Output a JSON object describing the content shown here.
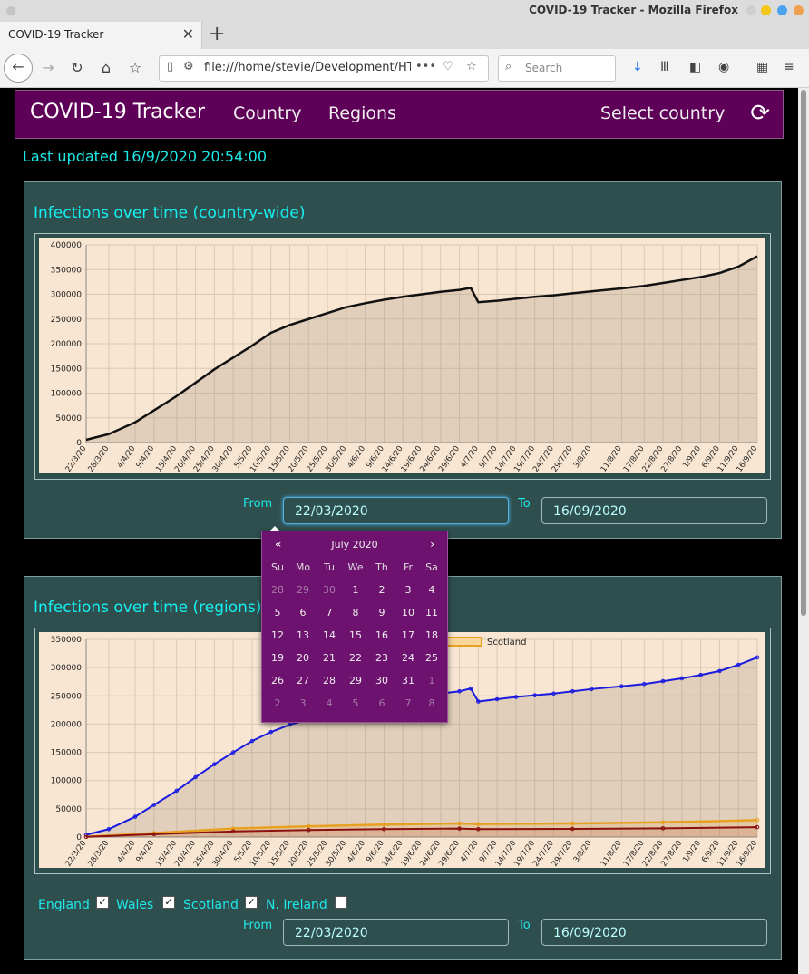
{
  "window": {
    "title": "COVID-19 Tracker - Mozilla Firefox"
  },
  "browser": {
    "tab_title": "COVID-19 Tracker",
    "url": "file:///home/stevie/Development/HT",
    "search_placeholder": "Search"
  },
  "app": {
    "brand": "COVID-19 Tracker",
    "nav": {
      "country": "Country",
      "regions": "Regions",
      "select_country": "Select country"
    },
    "last_updated": "Last updated 16/9/2020 20:54:00"
  },
  "country_chart": {
    "title": "Infections over time (country-wide)",
    "from_label": "From",
    "to_label": "To",
    "from_value": "22/03/2020",
    "to_value": "16/09/2020"
  },
  "regions_chart": {
    "title": "Infections over time (regions)",
    "from_label": "From",
    "to_label": "To",
    "from_value": "22/03/2020",
    "to_value": "16/09/2020",
    "checkboxes": [
      {
        "label": "England",
        "checked": true
      },
      {
        "label": "Wales",
        "checked": true
      },
      {
        "label": "Scotland",
        "checked": true
      },
      {
        "label": "N. Ireland",
        "checked": false
      }
    ]
  },
  "datepicker": {
    "month_label": "July 2020",
    "prev": "«",
    "next": "›",
    "weekdays": [
      "Su",
      "Mo",
      "Tu",
      "We",
      "Th",
      "Fr",
      "Sa"
    ],
    "weeks": [
      [
        {
          "d": "28",
          "m": true
        },
        {
          "d": "29",
          "m": true
        },
        {
          "d": "30",
          "m": true
        },
        {
          "d": "1"
        },
        {
          "d": "2"
        },
        {
          "d": "3"
        },
        {
          "d": "4"
        }
      ],
      [
        {
          "d": "5"
        },
        {
          "d": "6"
        },
        {
          "d": "7"
        },
        {
          "d": "8"
        },
        {
          "d": "9"
        },
        {
          "d": "10"
        },
        {
          "d": "11"
        }
      ],
      [
        {
          "d": "12"
        },
        {
          "d": "13"
        },
        {
          "d": "14"
        },
        {
          "d": "15"
        },
        {
          "d": "16"
        },
        {
          "d": "17"
        },
        {
          "d": "18"
        }
      ],
      [
        {
          "d": "19"
        },
        {
          "d": "20"
        },
        {
          "d": "21"
        },
        {
          "d": "22"
        },
        {
          "d": "23"
        },
        {
          "d": "24"
        },
        {
          "d": "25"
        }
      ],
      [
        {
          "d": "26"
        },
        {
          "d": "27"
        },
        {
          "d": "28"
        },
        {
          "d": "29"
        },
        {
          "d": "30"
        },
        {
          "d": "31"
        },
        {
          "d": "1",
          "m": true
        }
      ],
      [
        {
          "d": "2",
          "m": true
        },
        {
          "d": "3",
          "m": true
        },
        {
          "d": "4",
          "m": true
        },
        {
          "d": "5",
          "m": true
        },
        {
          "d": "6",
          "m": true
        },
        {
          "d": "7",
          "m": true
        },
        {
          "d": "8",
          "m": true
        }
      ]
    ]
  },
  "colors": {
    "navbar": "#5e0057",
    "card": "#2f4f4f",
    "accent_text": "#16f0f0",
    "chart_bg": "#f8e6d2",
    "picker": "#6e1270"
  },
  "chart_data": [
    {
      "type": "area",
      "ylim": [
        0,
        400000
      ],
      "yticks": [
        0,
        50000,
        100000,
        150000,
        200000,
        250000,
        300000,
        350000,
        400000
      ],
      "yticks_labels": [
        "0",
        "50000",
        "100000",
        "150000",
        "200000",
        "250000",
        "300000",
        "350000",
        "400000"
      ],
      "xtick_labels": [
        "22/3/20",
        "28/3/20",
        "4/4/20",
        "9/4/20",
        "15/4/20",
        "20/4/20",
        "25/4/20",
        "30/4/20",
        "5/5/20",
        "10/5/20",
        "15/5/20",
        "20/5/20",
        "25/5/20",
        "30/5/20",
        "4/6/20",
        "9/6/20",
        "14/6/20",
        "19/6/20",
        "24/6/20",
        "29/6/20",
        "4/7/20",
        "9/7/20",
        "14/7/20",
        "19/7/20",
        "24/7/20",
        "29/7/20",
        "3/8/20",
        "11/8/20",
        "17/8/20",
        "22/8/20",
        "27/8/20",
        "1/9/20",
        "6/9/20",
        "11/9/20",
        "16/9/20"
      ],
      "series": [
        {
          "color": "#111111",
          "x": [
            "22/3/20",
            "28/3/20",
            "4/4/20",
            "9/4/20",
            "15/4/20",
            "20/4/20",
            "25/4/20",
            "30/4/20",
            "5/5/20",
            "10/5/20",
            "15/5/20",
            "20/5/20",
            "25/5/20",
            "30/5/20",
            "4/6/20",
            "9/6/20",
            "14/6/20",
            "19/6/20",
            "24/6/20",
            "29/6/20",
            "2/7/20",
            "4/7/20",
            "9/7/20",
            "14/7/20",
            "19/7/20",
            "24/7/20",
            "29/7/20",
            "3/8/20",
            "11/8/20",
            "17/8/20",
            "22/8/20",
            "27/8/20",
            "1/9/20",
            "6/9/20",
            "11/9/20",
            "16/9/20"
          ],
          "values": [
            5500,
            17000,
            41000,
            65000,
            94000,
            121000,
            148000,
            172000,
            196000,
            222000,
            238000,
            250000,
            262000,
            274000,
            282000,
            289000,
            295000,
            300000,
            305000,
            309000,
            313000,
            284000,
            287000,
            291000,
            295000,
            298000,
            302000,
            306000,
            312000,
            317000,
            323000,
            329000,
            335000,
            343000,
            356000,
            377000
          ]
        }
      ]
    },
    {
      "type": "area",
      "ylim": [
        0,
        350000
      ],
      "yticks": [
        0,
        50000,
        100000,
        150000,
        200000,
        250000,
        300000,
        350000
      ],
      "yticks_labels": [
        "0",
        "50000",
        "100000",
        "150000",
        "200000",
        "250000",
        "300000",
        "350000"
      ],
      "legend": {
        "placement": "top",
        "visible_entries": [
          "Scotland"
        ]
      },
      "xtick_labels": [
        "22/3/20",
        "28/3/20",
        "4/4/20",
        "9/4/20",
        "15/4/20",
        "20/4/20",
        "25/4/20",
        "30/4/20",
        "5/5/20",
        "10/5/20",
        "15/5/20",
        "20/5/20",
        "25/5/20",
        "30/5/20",
        "4/6/20",
        "9/6/20",
        "14/6/20",
        "19/6/20",
        "24/6/20",
        "29/6/20",
        "4/7/20",
        "9/7/20",
        "14/7/20",
        "19/7/20",
        "24/7/20",
        "29/7/20",
        "3/8/20",
        "11/8/20",
        "17/8/20",
        "22/8/20",
        "27/8/20",
        "1/9/20",
        "6/9/20",
        "11/9/20",
        "16/9/20"
      ],
      "series": [
        {
          "color": "#1a1ae0",
          "x": [
            "22/3/20",
            "28/3/20",
            "4/4/20",
            "9/4/20",
            "15/4/20",
            "20/4/20",
            "25/4/20",
            "30/4/20",
            "5/5/20",
            "10/5/20",
            "15/5/20",
            "20/5/20",
            "25/5/20",
            "30/5/20",
            "4/6/20",
            "9/6/20",
            "14/6/20",
            "19/6/20",
            "24/6/20",
            "29/6/20",
            "2/7/20",
            "4/7/20",
            "9/7/20",
            "14/7/20",
            "19/7/20",
            "24/7/20",
            "29/7/20",
            "3/8/20",
            "11/8/20",
            "17/8/20",
            "22/8/20",
            "27/8/20",
            "1/9/20",
            "6/9/20",
            "11/9/20",
            "16/9/20"
          ],
          "values": [
            4000,
            14000,
            36000,
            57000,
            82000,
            106000,
            129000,
            150000,
            170000,
            186000,
            199000,
            208000,
            218000,
            227000,
            234000,
            240000,
            245000,
            250000,
            254000,
            258000,
            263000,
            240000,
            244000,
            248000,
            251000,
            254000,
            258000,
            262000,
            267000,
            271000,
            276000,
            281000,
            287000,
            294000,
            305000,
            318000
          ]
        },
        {
          "name": "Scotland",
          "color": "#e8a020",
          "x": [
            "22/3/20",
            "9/4/20",
            "30/4/20",
            "20/5/20",
            "9/6/20",
            "29/6/20",
            "4/7/20",
            "29/7/20",
            "22/8/20",
            "16/9/20"
          ],
          "values": [
            500,
            7000,
            15000,
            19000,
            22000,
            24000,
            23000,
            24000,
            26000,
            30000
          ]
        },
        {
          "color": "#8b1010",
          "x": [
            "22/3/20",
            "9/4/20",
            "30/4/20",
            "20/5/20",
            "9/6/20",
            "29/6/20",
            "4/7/20",
            "29/7/20",
            "22/8/20",
            "16/9/20"
          ],
          "values": [
            400,
            5000,
            10000,
            12500,
            14000,
            15000,
            14000,
            14500,
            15500,
            17500
          ]
        }
      ]
    }
  ]
}
